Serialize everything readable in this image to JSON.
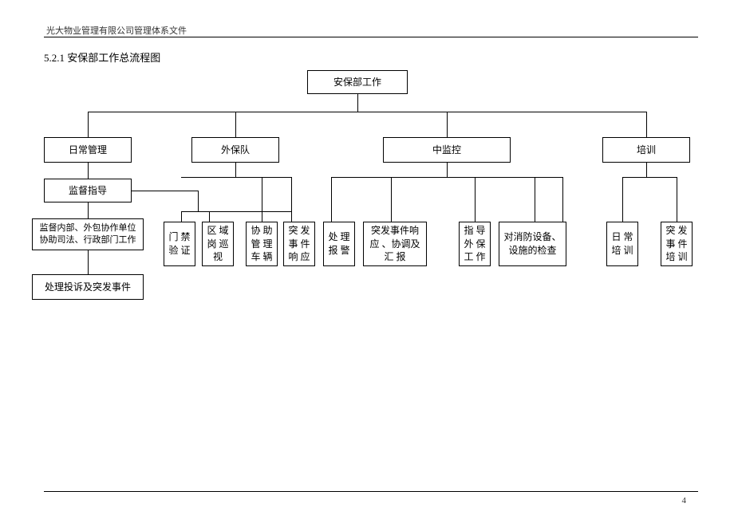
{
  "header": "光大物业管理有限公司管理体系文件",
  "section_title": "5.2.1 安保部工作总流程图",
  "page_number": "4",
  "nodes": {
    "root": "安保部工作",
    "daily_mgmt": "日常管理",
    "supervise": "监督指导",
    "supervise_detail": "监督内部、外包协作单位\n协助司法、行政部门工作",
    "complaints": "处理投诉及突发事件",
    "external_team": "外保队",
    "central_monitor": "中监控",
    "training": "培训",
    "access_verify": "门 禁\n验 证",
    "area_patrol": "区 域\n岗 巡\n视",
    "assist_vehicle": "协 助\n管 理\n车 辆",
    "emergency_response1": "突 发\n事 件\n响 应",
    "handle_alarm": "处 理\n报 警",
    "emergency_coord": "突发事件响\n应 、协调及\n汇 报",
    "guide_external": "指 导\n外 保\n工 作",
    "fire_check": "对消防设备、\n设施的检查",
    "daily_training": "日 常\n培 训",
    "emergency_training": "突 发\n事 件\n培 训"
  }
}
